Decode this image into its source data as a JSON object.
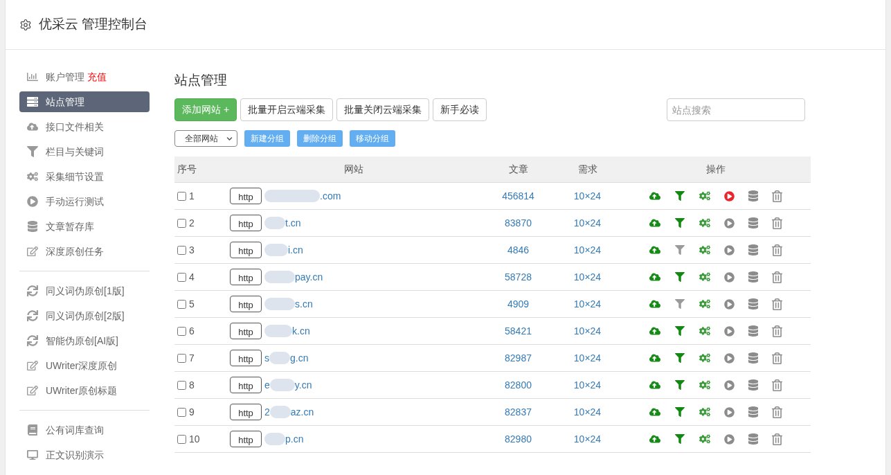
{
  "header": {
    "title": "优采云 管理控制台"
  },
  "sidebar": {
    "groups": [
      [
        {
          "label": "账户管理",
          "link": "充值",
          "selected": false
        },
        {
          "label": "站点管理",
          "selected": true
        },
        {
          "label": "接口文件相关",
          "selected": false
        },
        {
          "label": "栏目与关键词",
          "selected": false
        },
        {
          "label": "采集细节设置",
          "selected": false
        },
        {
          "label": "手动运行测试",
          "selected": false
        },
        {
          "label": "文章暂存库",
          "selected": false
        },
        {
          "label": "深度原创任务",
          "selected": false
        }
      ],
      [
        {
          "label": "同义词伪原创[1版]",
          "selected": false
        },
        {
          "label": "同义词伪原创[2版]",
          "selected": false
        },
        {
          "label": "智能伪原创[AI版]",
          "selected": false
        },
        {
          "label": "UWriter深度原创",
          "selected": false
        },
        {
          "label": "UWriter原创标题",
          "selected": false
        }
      ],
      [
        {
          "label": "公有词库查询",
          "selected": false
        },
        {
          "label": "正文识别演示",
          "selected": false
        }
      ]
    ]
  },
  "main": {
    "title": "站点管理",
    "toolbar": {
      "buttons": [
        {
          "label": "添加网站 +",
          "kind": "primary"
        },
        {
          "label": "批量开启云端采集",
          "kind": "default"
        },
        {
          "label": "批量关闭云端采集",
          "kind": "default"
        },
        {
          "label": "新手必读",
          "kind": "default"
        }
      ],
      "search": {
        "placeholder": "站点搜索"
      }
    },
    "group_bar": {
      "filter": "全部网站",
      "buttons": [
        "新建分组",
        "删除分组",
        "移动分组"
      ]
    },
    "table": {
      "columns": [
        "序号",
        "网站",
        "文章",
        "需求",
        "操作"
      ],
      "rows": [
        {
          "selected": false,
          "no": "1",
          "scheme": "http",
          "site_prefix": "",
          "site_suffix": ".com",
          "articles": "456814",
          "demand": "10×24",
          "filter_on": true,
          "running": true
        },
        {
          "selected": false,
          "no": "2",
          "scheme": "http",
          "site_prefix": "",
          "site_suffix": "t.cn",
          "articles": "83870",
          "demand": "10×24",
          "filter_on": true,
          "running": false
        },
        {
          "selected": false,
          "no": "3",
          "scheme": "http",
          "site_prefix": "",
          "site_suffix": "i.cn",
          "articles": "4846",
          "demand": "10×24",
          "filter_on": false,
          "running": false
        },
        {
          "selected": false,
          "no": "4",
          "scheme": "http",
          "site_prefix": "",
          "site_suffix": "pay.cn",
          "articles": "58728",
          "demand": "10×24",
          "filter_on": true,
          "running": false
        },
        {
          "selected": false,
          "no": "5",
          "scheme": "http",
          "site_prefix": "",
          "site_suffix": "s.cn",
          "articles": "4909",
          "demand": "10×24",
          "filter_on": false,
          "running": false
        },
        {
          "selected": false,
          "no": "6",
          "scheme": "http",
          "site_prefix": "",
          "site_suffix": "k.cn",
          "articles": "58421",
          "demand": "10×24",
          "filter_on": true,
          "running": false
        },
        {
          "selected": false,
          "no": "7",
          "scheme": "http",
          "site_prefix": "s",
          "site_suffix": "g.cn",
          "articles": "82987",
          "demand": "10×24",
          "filter_on": true,
          "running": false
        },
        {
          "selected": false,
          "no": "8",
          "scheme": "http",
          "site_prefix": "e",
          "site_suffix": "y.cn",
          "articles": "82800",
          "demand": "10×24",
          "filter_on": true,
          "running": false
        },
        {
          "selected": false,
          "no": "9",
          "scheme": "http",
          "site_prefix": "2",
          "site_suffix": "az.cn",
          "articles": "82837",
          "demand": "10×24",
          "filter_on": true,
          "running": false
        },
        {
          "selected": false,
          "no": "10",
          "scheme": "http",
          "site_prefix": "",
          "site_suffix": "p.cn",
          "articles": "82980",
          "demand": "10×24",
          "filter_on": true,
          "running": false
        }
      ]
    }
  }
}
